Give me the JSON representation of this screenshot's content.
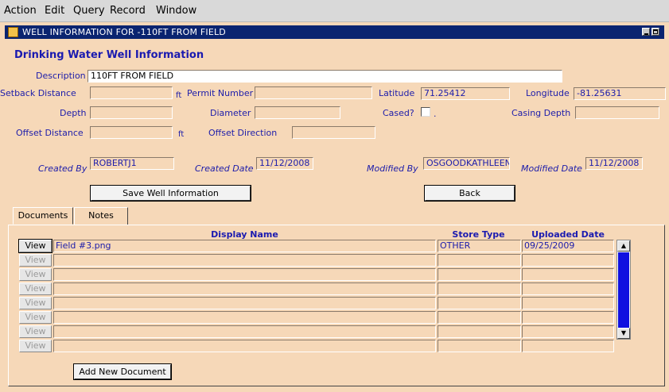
{
  "menu": {
    "action": "Action",
    "edit": "Edit",
    "query": "Query",
    "record": "Record",
    "window": "Window"
  },
  "window": {
    "title": "WELL INFORMATION FOR -110FT FROM FIELD"
  },
  "form": {
    "heading": "Drinking Water Well Information",
    "description_label": "Description",
    "description_value": "110FT FROM FIELD",
    "setback_label": "Setback Distance",
    "setback_value": "",
    "setback_unit": "ft",
    "permit_label": "Permit Number",
    "permit_value": "",
    "latitude_label": "Latitude",
    "latitude_value": "71.25412",
    "longitude_label": "Longitude",
    "longitude_value": "-81.25631",
    "depth_label": "Depth",
    "depth_value": "",
    "diameter_label": "Diameter",
    "diameter_value": "",
    "cased_label": "Cased?",
    "cased_dot": ".",
    "casing_depth_label": "Casing Depth",
    "casing_depth_value": "",
    "offset_distance_label": "Offset Distance",
    "offset_distance_value": "",
    "offset_unit": "ft",
    "offset_direction_label": "Offset Direction",
    "offset_direction_value": "",
    "created_by_label": "Created By",
    "created_by_value": "ROBERTJ1",
    "created_date_label": "Created Date",
    "created_date_value": "11/12/2008",
    "modified_by_label": "Modified By",
    "modified_by_value": "OSGOODKATHLEEN",
    "modified_date_label": "Modified Date",
    "modified_date_value": "11/12/2008",
    "save_button": "Save Well Information",
    "back_button": "Back"
  },
  "tabs": {
    "documents": "Documents",
    "notes": "Notes"
  },
  "documents": {
    "col_display_name": "Display Name",
    "col_store_type": "Store Type",
    "col_uploaded_date": "Uploaded Date",
    "view_label": "View",
    "rows": [
      {
        "name": "Field #3.png",
        "type": "OTHER",
        "date": "09/25/2009"
      },
      {
        "name": "",
        "type": "",
        "date": ""
      },
      {
        "name": "",
        "type": "",
        "date": ""
      },
      {
        "name": "",
        "type": "",
        "date": ""
      },
      {
        "name": "",
        "type": "",
        "date": ""
      },
      {
        "name": "",
        "type": "",
        "date": ""
      },
      {
        "name": "",
        "type": "",
        "date": ""
      },
      {
        "name": "",
        "type": "",
        "date": ""
      }
    ],
    "add_button": "Add New Document"
  },
  "icons": {
    "window_icon": "app-icon",
    "minimize": "minimize-icon",
    "maximize": "maximize-icon",
    "scroll_up": "scroll-up-arrow-icon",
    "scroll_down": "scroll-down-arrow-icon"
  }
}
